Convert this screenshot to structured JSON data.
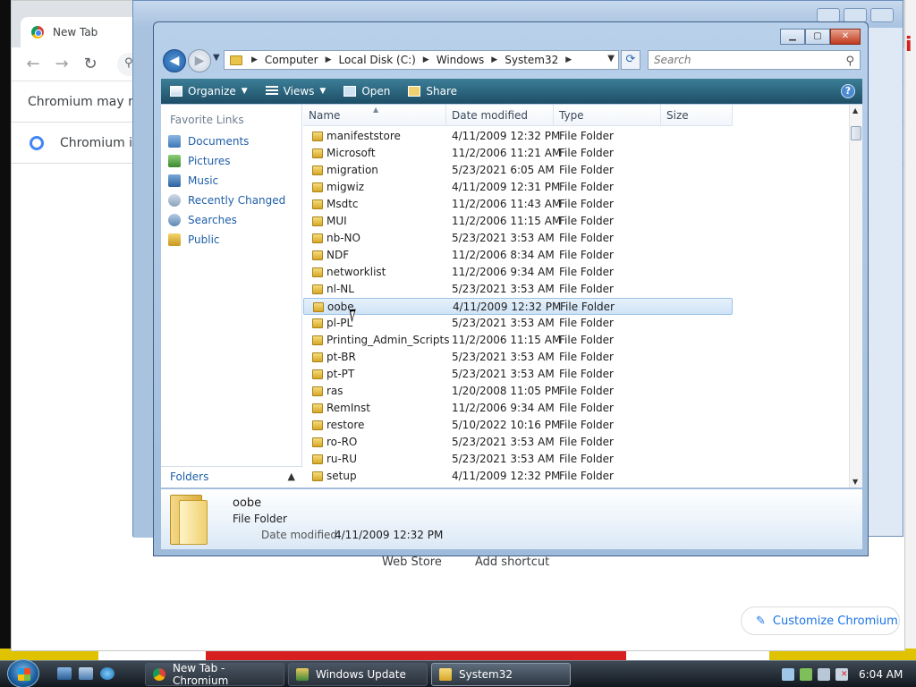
{
  "chrome": {
    "tab_title": "New Tab",
    "info_bar_1": "Chromium may not f",
    "info_bar_2": "Chromium isn't",
    "ntp_links": [
      "Web Store",
      "Add shortcut"
    ],
    "customize_label": "Customize Chromium"
  },
  "explorer": {
    "breadcrumbs": [
      "Computer",
      "Local Disk (C:)",
      "Windows",
      "System32"
    ],
    "search_placeholder": "Search",
    "commands": {
      "organize": "Organize",
      "views": "Views",
      "open": "Open",
      "share": "Share"
    },
    "favorite_links_title": "Favorite Links",
    "favorite_links": [
      "Documents",
      "Pictures",
      "Music",
      "Recently Changed",
      "Searches",
      "Public"
    ],
    "folders_label": "Folders",
    "columns": [
      "Name",
      "Date modified",
      "Type",
      "Size"
    ],
    "rows": [
      {
        "name": "manifeststore",
        "date": "4/11/2009 12:32 PM",
        "type": "File Folder"
      },
      {
        "name": "Microsoft",
        "date": "11/2/2006 11:21 AM",
        "type": "File Folder"
      },
      {
        "name": "migration",
        "date": "5/23/2021 6:05 AM",
        "type": "File Folder"
      },
      {
        "name": "migwiz",
        "date": "4/11/2009 12:31 PM",
        "type": "File Folder"
      },
      {
        "name": "Msdtc",
        "date": "11/2/2006 11:43 AM",
        "type": "File Folder"
      },
      {
        "name": "MUI",
        "date": "11/2/2006 11:15 AM",
        "type": "File Folder"
      },
      {
        "name": "nb-NO",
        "date": "5/23/2021 3:53 AM",
        "type": "File Folder"
      },
      {
        "name": "NDF",
        "date": "11/2/2006 8:34 AM",
        "type": "File Folder"
      },
      {
        "name": "networklist",
        "date": "11/2/2006 9:34 AM",
        "type": "File Folder"
      },
      {
        "name": "nl-NL",
        "date": "5/23/2021 3:53 AM",
        "type": "File Folder"
      },
      {
        "name": "oobe",
        "date": "4/11/2009 12:32 PM",
        "type": "File Folder",
        "selected": true
      },
      {
        "name": "pl-PL",
        "date": "5/23/2021 3:53 AM",
        "type": "File Folder"
      },
      {
        "name": "Printing_Admin_Scripts",
        "date": "11/2/2006 11:15 AM",
        "type": "File Folder"
      },
      {
        "name": "pt-BR",
        "date": "5/23/2021 3:53 AM",
        "type": "File Folder"
      },
      {
        "name": "pt-PT",
        "date": "5/23/2021 3:53 AM",
        "type": "File Folder"
      },
      {
        "name": "ras",
        "date": "1/20/2008 11:05 PM",
        "type": "File Folder"
      },
      {
        "name": "RemInst",
        "date": "11/2/2006 9:34 AM",
        "type": "File Folder"
      },
      {
        "name": "restore",
        "date": "5/10/2022 10:16 PM",
        "type": "File Folder"
      },
      {
        "name": "ro-RO",
        "date": "5/23/2021 3:53 AM",
        "type": "File Folder"
      },
      {
        "name": "ru-RU",
        "date": "5/23/2021 3:53 AM",
        "type": "File Folder"
      },
      {
        "name": "setup",
        "date": "4/11/2009 12:32 PM",
        "type": "File Folder"
      }
    ],
    "details": {
      "name": "oobe",
      "type": "File Folder",
      "modified_label": "Date modified:",
      "modified_value": "4/11/2009 12:32 PM"
    }
  },
  "taskbar": {
    "buttons": [
      "New Tab - Chromium",
      "Windows Update",
      "System32"
    ],
    "clock": "6:04 AM"
  },
  "colors": {
    "accent": "#1f5fa8",
    "command_bar": "#1d4e66",
    "selection": "#cfe3f6"
  }
}
